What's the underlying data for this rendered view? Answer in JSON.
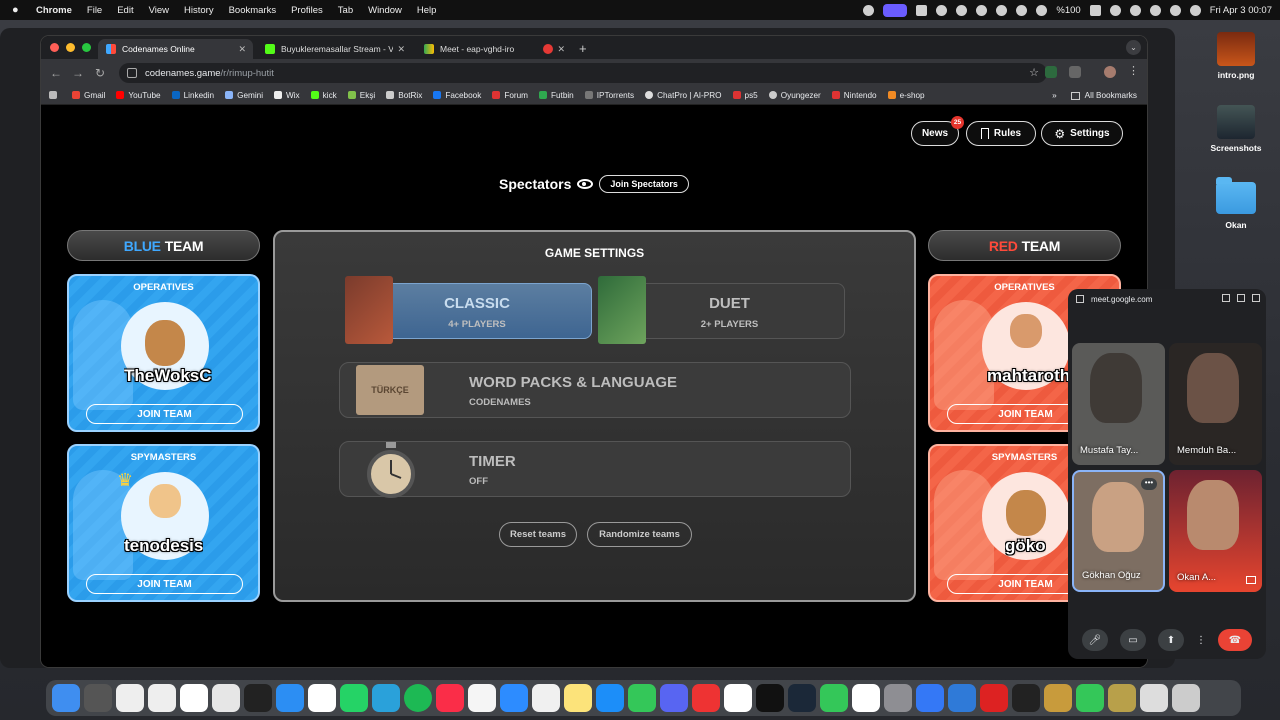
{
  "menubar": {
    "app": "Chrome",
    "items": [
      "File",
      "Edit",
      "View",
      "History",
      "Bookmarks",
      "Profiles",
      "Tab",
      "Window",
      "Help"
    ],
    "battery": "%100",
    "datetime": "Fri Apr 3  00:07"
  },
  "desktop": {
    "icons": [
      {
        "label": "intro.png"
      },
      {
        "label": "Screenshots"
      },
      {
        "label": "Okan"
      }
    ]
  },
  "browser": {
    "tabs": [
      {
        "title": "Codenames Online",
        "active": true
      },
      {
        "title": "Buyukleremasallar Stream - V",
        "active": false
      },
      {
        "title": "Meet - eap-vghd-iro",
        "active": false
      },
      {
        "title": "",
        "active": false
      }
    ],
    "url_host": "codenames.game",
    "url_path": "/r/rimup-hutit",
    "bookmarks": [
      "Gmail",
      "YouTube",
      "Linkedin",
      "Gemini",
      "Wix",
      "kick",
      "Ekşi",
      "BotRix",
      "Facebook",
      "Forum",
      "Futbin",
      "IPTorrents",
      "ChatPro | AI-PRO",
      "ps5",
      "Oyungezer",
      "Nintendo",
      "e-shop"
    ],
    "all_bookmarks": "All Bookmarks"
  },
  "game": {
    "top_buttons": {
      "news": "News",
      "news_badge": "25",
      "rules": "Rules",
      "settings": "Settings"
    },
    "spectators": {
      "title": "Spectators",
      "join": "Join Spectators"
    },
    "blue_team": {
      "word": "BLUE",
      "team": "TEAM",
      "operatives": {
        "title": "OPERATIVES",
        "player": "TheWoksC",
        "join": "JOIN TEAM"
      },
      "spymasters": {
        "title": "SPYMASTERS",
        "player": "tenodesis",
        "join": "JOIN TEAM"
      }
    },
    "red_team": {
      "word": "RED",
      "team": "TEAM",
      "operatives": {
        "title": "OPERATIVES",
        "player": "mahtaroth",
        "join": "JOIN TEAM"
      },
      "spymasters": {
        "title": "SPYMASTERS",
        "player": "göko",
        "join": "JOIN TEAM"
      }
    },
    "settings": {
      "title": "GAME SETTINGS",
      "classic": {
        "label": "CLASSIC",
        "sub": "4+ PLAYERS",
        "selected": true
      },
      "duet": {
        "label": "DUET",
        "sub": "2+ PLAYERS",
        "selected": false
      },
      "word_packs": {
        "label": "WORD PACKS & LANGUAGE",
        "sub": "CODENAMES",
        "box": "TÜRKÇE"
      },
      "timer": {
        "label": "TIMER",
        "sub": "OFF"
      },
      "reset": "Reset teams",
      "randomize": "Randomize teams"
    }
  },
  "meet": {
    "host": "meet.google.com",
    "participants": [
      {
        "name": "Mustafa Tay..."
      },
      {
        "name": "Memduh Ba..."
      },
      {
        "name": "Gökhan Oğuz"
      },
      {
        "name": "Okan A..."
      }
    ]
  },
  "colors": {
    "blue": "#3fa8ff",
    "red": "#ff4a3a",
    "end_call": "#ea4335"
  }
}
